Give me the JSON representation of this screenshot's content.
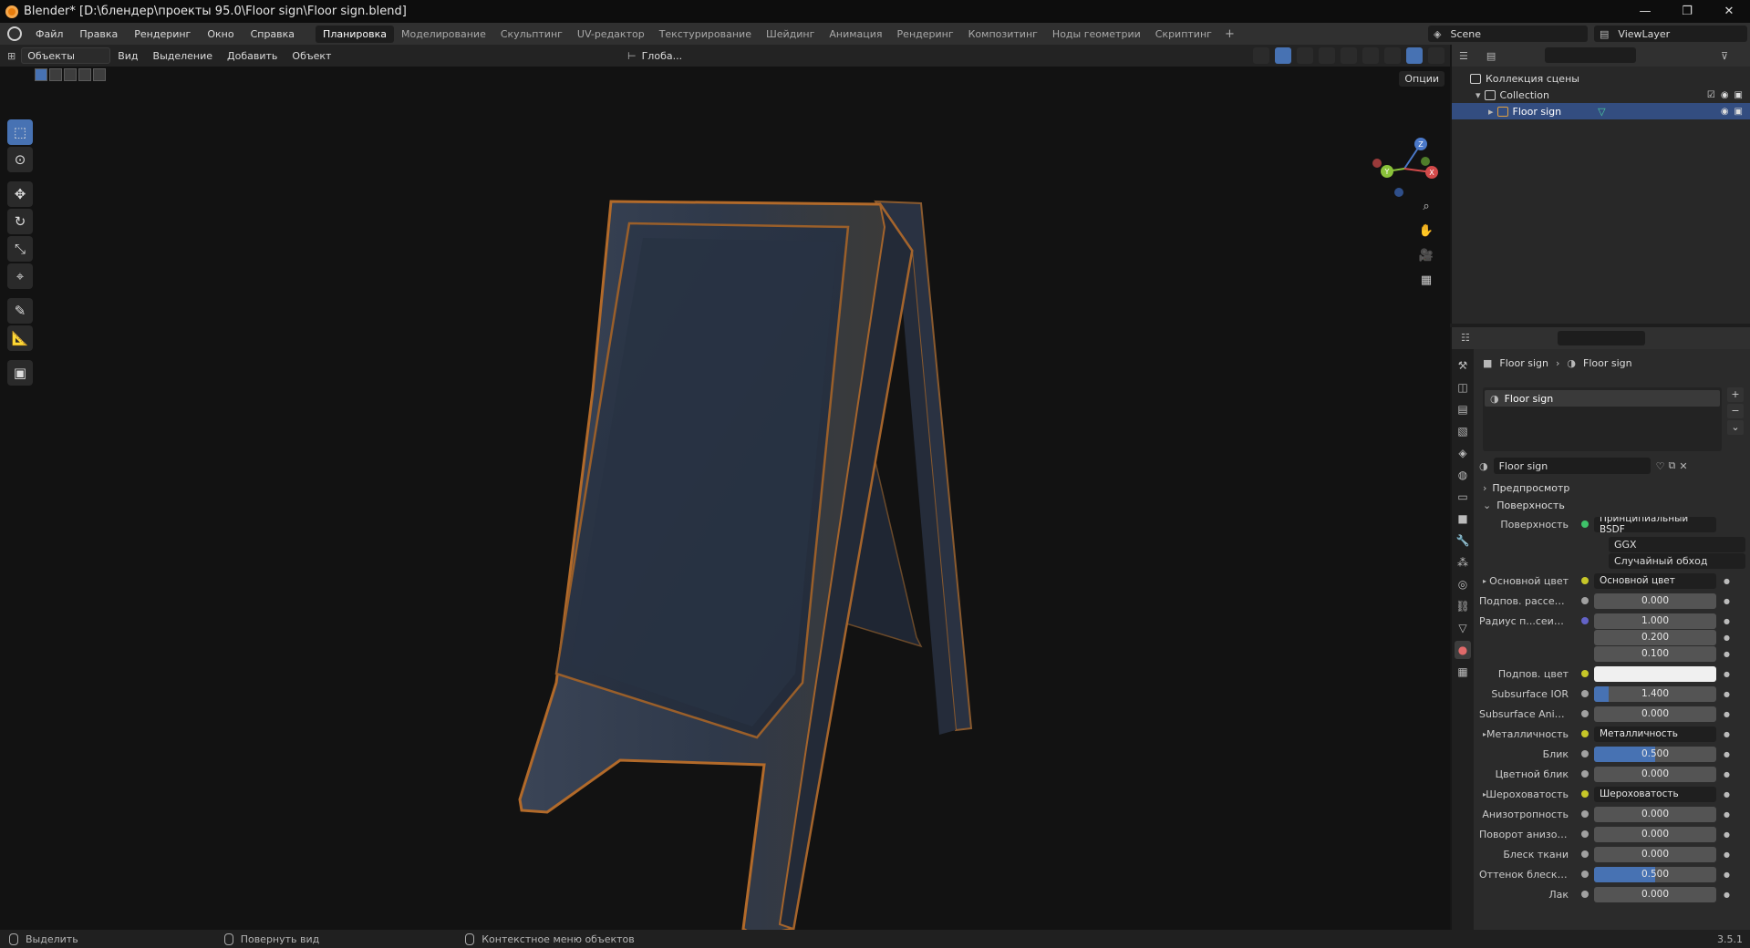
{
  "window": {
    "title": "Blender* [D:\\блендер\\проекты 95.0\\Floor sign\\Floor sign.blend]",
    "controls": [
      "—",
      "❐",
      "✕"
    ]
  },
  "menu": {
    "items": [
      "Файл",
      "Правка",
      "Рендеринг",
      "Окно",
      "Справка"
    ],
    "workspaces": [
      "Планировка",
      "Моделирование",
      "Скульптинг",
      "UV-редактор",
      "Текстурирование",
      "Шейдинг",
      "Анимация",
      "Рендеринг",
      "Композитинг",
      "Ноды геометрии",
      "Скриптинг"
    ],
    "active_workspace_index": 0,
    "add_tab": "+",
    "scene": "Scene",
    "view_layer": "ViewLayer"
  },
  "viewport": {
    "mode": "Объекты",
    "header_items": [
      "Вид",
      "Выделение",
      "Добавить",
      "Объект"
    ],
    "transform": "Глоба...",
    "options": "Опции",
    "gizmo": {
      "z": "Z",
      "y": "Y",
      "x": "X"
    }
  },
  "outliner": {
    "scene_collection": "Коллекция сцены",
    "collection": "Collection",
    "object": "Floor sign"
  },
  "properties": {
    "breadcrumb_object": "Floor sign",
    "breadcrumb_material": "Floor sign",
    "slot": "Floor sign",
    "material_name": "Floor sign",
    "section_preview": "Предпросмотр",
    "section_surface": "Поверхность",
    "surface_label": "Поверхность",
    "surface_value": "Принципиальный BSDF",
    "distribution": "GGX",
    "subsurface_method": "Случайный обход",
    "rows": [
      {
        "label": "Основной цвет",
        "value": "Основной цвет",
        "kind": "link",
        "arrow": true
      },
      {
        "label": "Подпов. рассеива...",
        "value": "0.000",
        "kind": "num"
      },
      {
        "label": "Радиус п...сеивания",
        "value": "1.000",
        "kind": "vec"
      },
      {
        "label": "",
        "value": "0.200",
        "kind": "vec2"
      },
      {
        "label": "",
        "value": "0.100",
        "kind": "vec2"
      },
      {
        "label": "Подпов. цвет",
        "value": "",
        "kind": "color"
      },
      {
        "label": "Subsurface IOR",
        "value": "1.400",
        "kind": "num",
        "fill": 0.12
      },
      {
        "label": "Subsurface Anisotr...",
        "value": "0.000",
        "kind": "num"
      },
      {
        "label": "Металличность",
        "value": "Металличность",
        "kind": "link",
        "arrow": true
      },
      {
        "label": "Блик",
        "value": "0.500",
        "kind": "num",
        "fill": 0.5
      },
      {
        "label": "Цветной блик",
        "value": "0.000",
        "kind": "num"
      },
      {
        "label": "Шероховатость",
        "value": "Шероховатость",
        "kind": "link",
        "arrow": true
      },
      {
        "label": "Анизотропность",
        "value": "0.000",
        "kind": "num"
      },
      {
        "label": "Поворот анизотро...",
        "value": "0.000",
        "kind": "num"
      },
      {
        "label": "Блеск ткани",
        "value": "0.000",
        "kind": "num"
      },
      {
        "label": "Оттенок блеска тк...",
        "value": "0.500",
        "kind": "num",
        "fill": 0.5
      },
      {
        "label": "Лак",
        "value": "0.000",
        "kind": "num"
      }
    ]
  },
  "status": {
    "select": "Выделить",
    "rotate": "Повернуть вид",
    "context": "Контекстное меню объектов",
    "version": "3.5.1"
  },
  "colors": {
    "accent": "#4772b3",
    "socket_yellow": "#c7c729",
    "socket_purple": "#6363c7",
    "sign_board": "#2a3344",
    "sign_edge": "#b26a2a"
  }
}
